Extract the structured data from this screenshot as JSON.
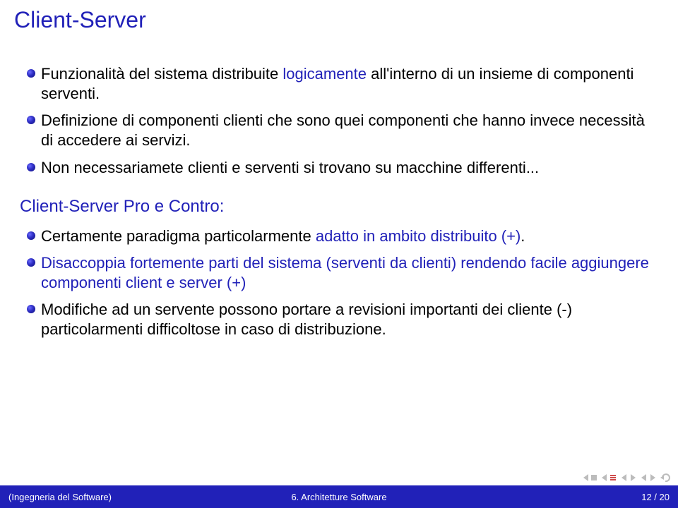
{
  "title": "Client-Server",
  "section1": {
    "items": [
      {
        "plain_a": "Funzionalità del sistema distribuite ",
        "blue": "logicamente",
        "plain_b": " all'interno di un insieme di componenti serventi."
      },
      {
        "plain_a": "Definizione di componenti clienti che sono quei componenti che hanno invece necessità di accedere ai servizi.",
        "blue": "",
        "plain_b": ""
      },
      {
        "plain_a": "Non necessariamete clienti e serventi si trovano su macchine differenti...",
        "blue": "",
        "plain_b": ""
      }
    ]
  },
  "subtitle": "Client-Server Pro e Contro:",
  "section2": {
    "items": [
      {
        "plain_a": "Certamente paradigma particolarmente ",
        "blue": "adatto in ambito distribuito (+)",
        "plain_b": "."
      },
      {
        "plain_a": "",
        "blue": "Disaccoppia fortemente parti del sistema (serventi da clienti) rendendo facile aggiungere componenti client e server (+)",
        "plain_b": ""
      },
      {
        "plain_a": "Modifiche ad un servente possono portare a revisioni importanti dei cliente (-) particolarmenti difficoltose in caso di distribuzione.",
        "blue": "",
        "plain_b": ""
      }
    ]
  },
  "footer": {
    "left": "(Ingegneria del Software)",
    "center": "6. Architetture Software",
    "right": "12 / 20"
  }
}
